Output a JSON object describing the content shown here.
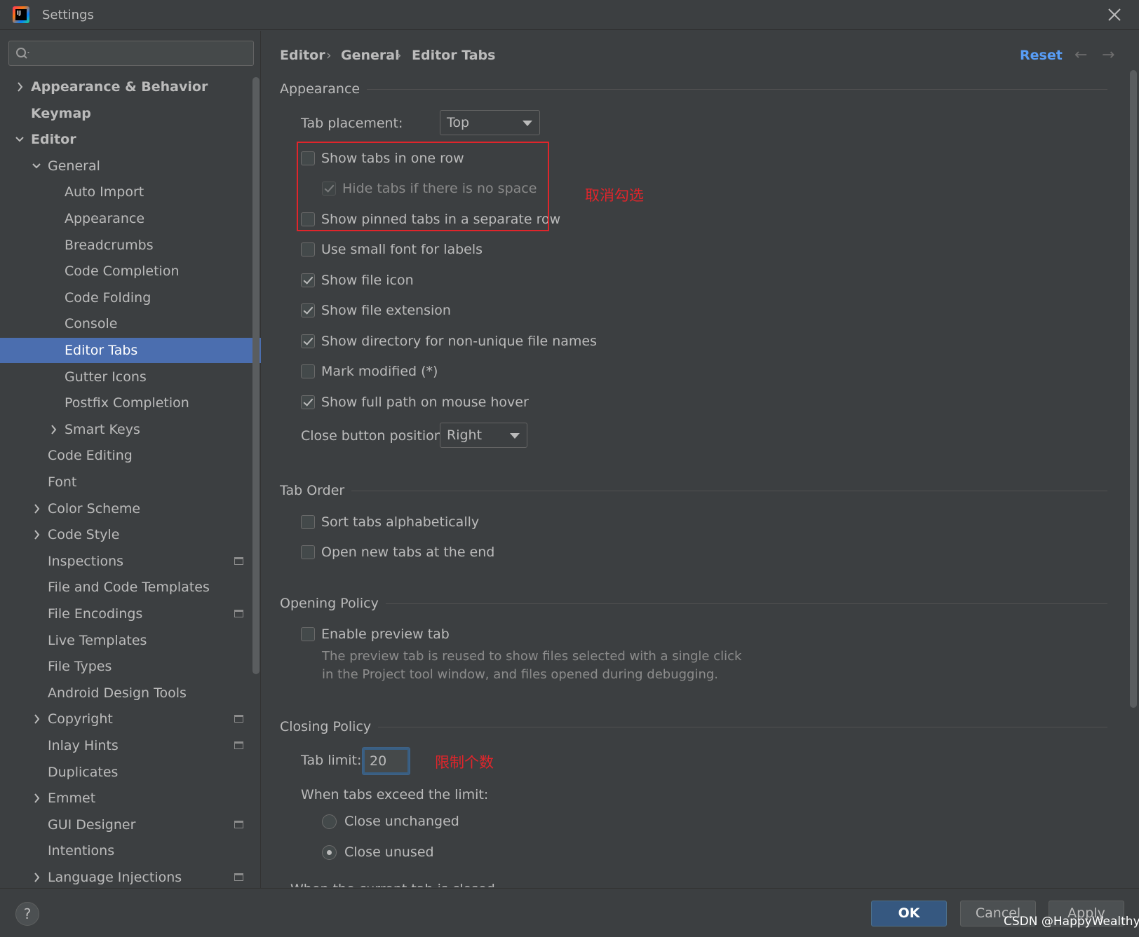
{
  "window": {
    "title": "Settings",
    "logo_text": "IJ"
  },
  "sidebar": {
    "search_placeholder": "",
    "items": [
      {
        "label": "Appearance & Behavior",
        "bold": true,
        "chevron": "right",
        "level": 0
      },
      {
        "label": "Keymap",
        "bold": true,
        "chevron": "",
        "level": 0
      },
      {
        "label": "Editor",
        "bold": true,
        "chevron": "down",
        "level": 0
      },
      {
        "label": "General",
        "bold": false,
        "chevron": "down",
        "level": 1
      },
      {
        "label": "Auto Import",
        "level": 2
      },
      {
        "label": "Appearance",
        "level": 2
      },
      {
        "label": "Breadcrumbs",
        "level": 2
      },
      {
        "label": "Code Completion",
        "level": 2
      },
      {
        "label": "Code Folding",
        "level": 2
      },
      {
        "label": "Console",
        "level": 2
      },
      {
        "label": "Editor Tabs",
        "level": 2,
        "selected": true
      },
      {
        "label": "Gutter Icons",
        "level": 2
      },
      {
        "label": "Postfix Completion",
        "level": 2
      },
      {
        "label": "Smart Keys",
        "level": 2,
        "chevron": "right"
      },
      {
        "label": "Code Editing",
        "level": 1
      },
      {
        "label": "Font",
        "level": 1
      },
      {
        "label": "Color Scheme",
        "level": 1,
        "chevron": "right"
      },
      {
        "label": "Code Style",
        "level": 1,
        "chevron": "right"
      },
      {
        "label": "Inspections",
        "level": 1,
        "project_icon": true
      },
      {
        "label": "File and Code Templates",
        "level": 1
      },
      {
        "label": "File Encodings",
        "level": 1,
        "project_icon": true
      },
      {
        "label": "Live Templates",
        "level": 1
      },
      {
        "label": "File Types",
        "level": 1
      },
      {
        "label": "Android Design Tools",
        "level": 1
      },
      {
        "label": "Copyright",
        "level": 1,
        "chevron": "right",
        "project_icon": true
      },
      {
        "label": "Inlay Hints",
        "level": 1,
        "project_icon": true
      },
      {
        "label": "Duplicates",
        "level": 1
      },
      {
        "label": "Emmet",
        "level": 1,
        "chevron": "right"
      },
      {
        "label": "GUI Designer",
        "level": 1,
        "project_icon": true
      },
      {
        "label": "Intentions",
        "level": 1
      },
      {
        "label": "Language Injections",
        "level": 1,
        "chevron": "right",
        "project_icon": true
      }
    ]
  },
  "breadcrumb": {
    "items": [
      "Editor",
      "General",
      "Editor Tabs"
    ],
    "separator": "›"
  },
  "header": {
    "reset_label": "Reset",
    "back_icon": "←",
    "forward_icon": "→"
  },
  "appearance": {
    "section_title": "Appearance",
    "tab_placement_label": "Tab placement:",
    "tab_placement_value": "Top",
    "show_tabs_one_row": {
      "label": "Show tabs in one row",
      "checked": false
    },
    "hide_tabs_no_space": {
      "label": "Hide tabs if there is no space",
      "checked": true,
      "disabled": true
    },
    "show_pinned_separate": {
      "label": "Show pinned tabs in a separate row",
      "checked": false
    },
    "small_font": {
      "label": "Use small font for labels",
      "checked": false
    },
    "show_file_icon": {
      "label": "Show file icon",
      "checked": true
    },
    "show_file_ext": {
      "label": "Show file extension",
      "checked": true
    },
    "show_directory": {
      "label": "Show directory for non-unique file names",
      "checked": true
    },
    "mark_modified": {
      "label": "Mark modified (*)",
      "checked": false
    },
    "show_full_path": {
      "label": "Show full path on mouse hover",
      "checked": true
    },
    "close_button_label": "Close button position:",
    "close_button_value": "Right"
  },
  "tab_order": {
    "section_title": "Tab Order",
    "sort_alpha": {
      "label": "Sort tabs alphabetically",
      "checked": false
    },
    "open_at_end": {
      "label": "Open new tabs at the end",
      "checked": false
    }
  },
  "opening_policy": {
    "section_title": "Opening Policy",
    "preview_tab": {
      "label": "Enable preview tab",
      "checked": false
    },
    "help_line1": "The preview tab is reused to show files selected with a single click",
    "help_line2": "in the Project tool window, and files opened during debugging."
  },
  "closing_policy": {
    "section_title": "Closing Policy",
    "tab_limit_label": "Tab limit:",
    "tab_limit_value": "20",
    "exceed_label": "When tabs exceed the limit:",
    "close_unchanged": {
      "label": "Close unchanged",
      "checked": false
    },
    "close_unused": {
      "label": "Close unused",
      "checked": true
    },
    "cut_off_text": "When the current tab is closed, activate:"
  },
  "annotations": {
    "uncheck_note": "取消勾选",
    "limit_note": "限制个数",
    "highlight_color": "#e0252b"
  },
  "footer": {
    "help_label": "?",
    "ok_label": "OK",
    "cancel_label": "Cancel",
    "apply_label": "Apply",
    "watermark": "CSDN @HappyWealthy"
  },
  "colors": {
    "background": "#3c3f41",
    "selection": "#4b6eaf",
    "link": "#589df6",
    "ok_button": "#365880"
  }
}
